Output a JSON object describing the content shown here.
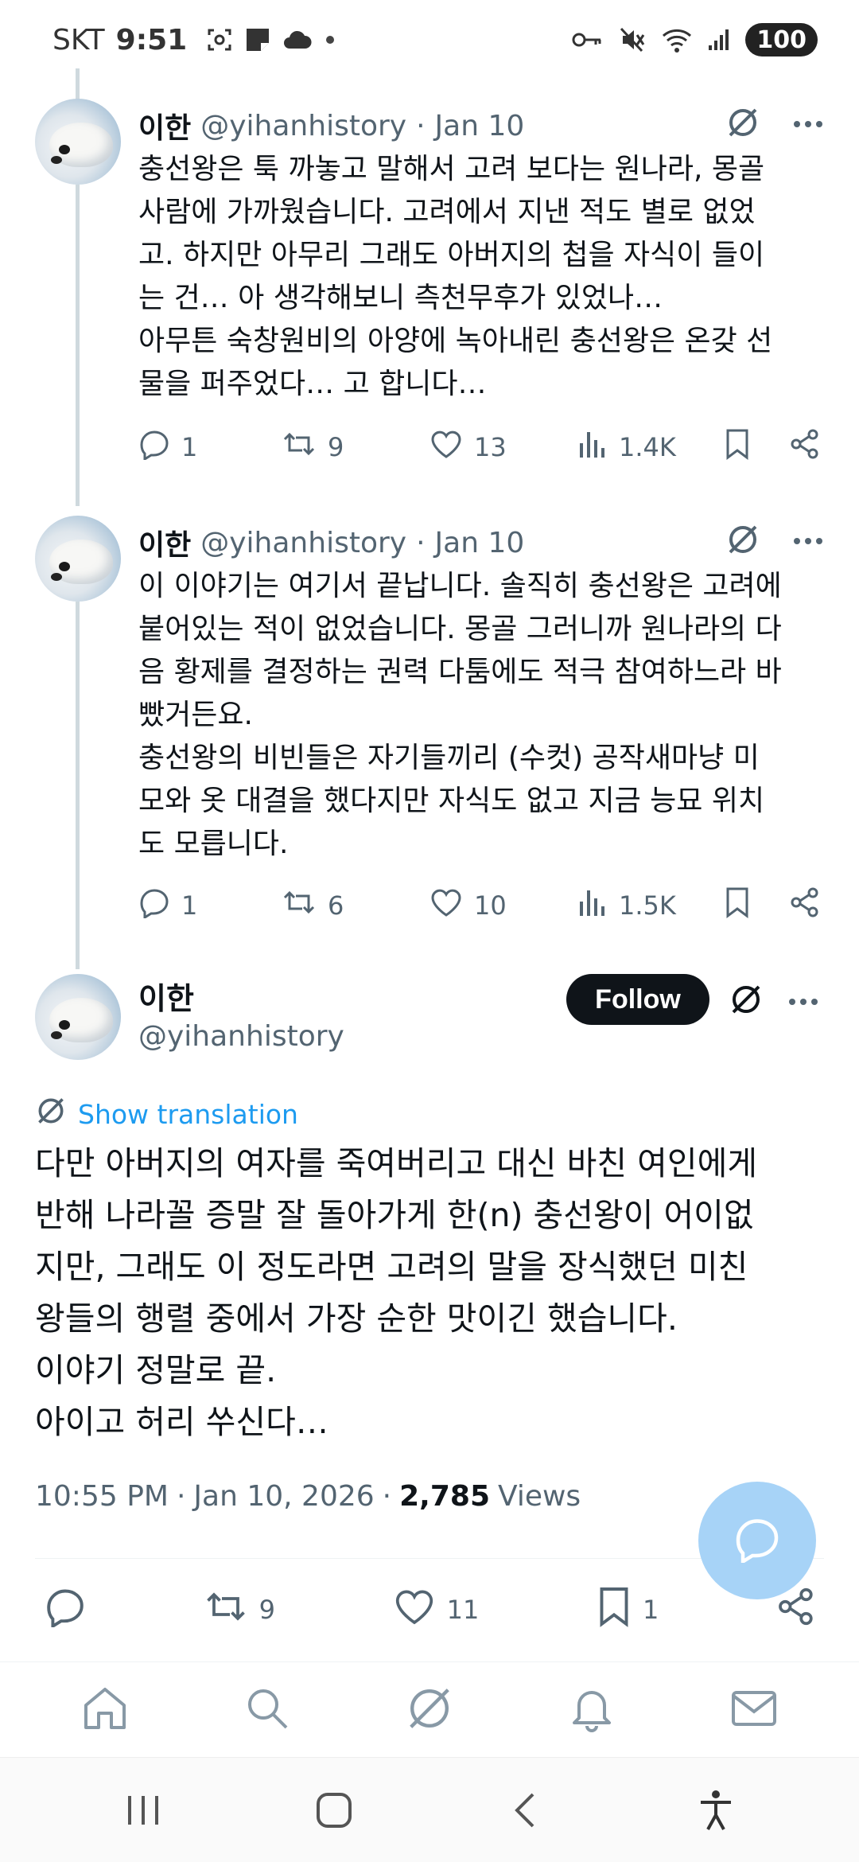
{
  "status_bar": {
    "carrier": "SKT",
    "time": "9:51",
    "battery": "100"
  },
  "thread": [
    {
      "name": "이한",
      "handle": "@yihanhistory",
      "separator": "·",
      "date": "Jan 10",
      "text": "충선왕은 툭 까놓고 말해서 고려 보다는 원나라, 몽골\n사람에 가까웠습니다. 고려에서 지낸 적도 별로 없었\n고. 하지만 아무리 그래도 아버지의 첩을 자식이 들이\n는 건… 아 생각해보니 측천무후가 있었나…\n아무튼 숙창원비의 아양에 녹아내린 충선왕은 온갖 선\n물을 퍼주었다… 고 합니다…",
      "replies": "1",
      "retweets": "9",
      "likes": "13",
      "views": "1.4K"
    },
    {
      "name": "이한",
      "handle": "@yihanhistory",
      "separator": "·",
      "date": "Jan 10",
      "text": "이 이야기는 여기서 끝납니다. 솔직히 충선왕은 고려에\n붙어있는 적이 없었습니다. 몽골 그러니까 원나라의 다\n음 황제를 결정하는 권력 다툼에도 적극 참여하느라 바\n빴거든요.\n충선왕의 비빈들은 자기들끼리 (수컷) 공작새마냥 미\n모와 옷 대결을 했다지만 자식도 없고 지금 능묘 위치\n도 모릅니다.",
      "replies": "1",
      "retweets": "6",
      "likes": "10",
      "views": "1.5K"
    }
  ],
  "main_tweet": {
    "name": "이한",
    "handle": "@yihanhistory",
    "follow_label": "Follow",
    "translation_label": "Show translation",
    "text": "다만 아버지의 여자를 죽여버리고 대신 바친 여인에게\n반해 나라꼴 증말 잘 돌아가게 한(n) 충선왕이 어이없\n지만, 그래도 이 정도라면 고려의 말을 장식했던 미친\n왕들의 행렬 중에서 가장 순한 맛이긴 했습니다.\n이야기 정말로 끝.\n아이고 허리 쑤신다…",
    "time": "10:55 PM",
    "sep1": "·",
    "date": "Jan 10, 2026",
    "sep2": "·",
    "views_count": "2,785",
    "views_label": "Views",
    "retweets": "9",
    "likes": "11",
    "bookmarks": "1"
  },
  "colors": {
    "accent": "#1d9bf0",
    "text_primary": "#0f1419",
    "text_secondary": "#536471",
    "thread_line": "#cfd9de",
    "fab": "#a7d3f7"
  },
  "icons": {
    "tweet_tools": [
      "grok-icon",
      "more-icon"
    ],
    "bottom_nav": [
      "home-icon",
      "search-icon",
      "grok-icon",
      "notifications-icon",
      "messages-icon"
    ],
    "system_nav": [
      "recent-apps-icon",
      "home-button-icon",
      "back-icon",
      "accessibility-icon"
    ]
  }
}
